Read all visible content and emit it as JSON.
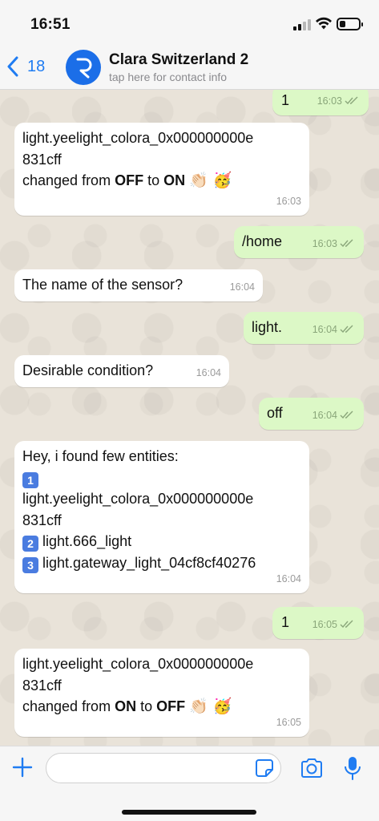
{
  "status_bar": {
    "time": "16:51",
    "battery_level": 0.3
  },
  "header": {
    "back_count": "18",
    "contact_name": "Clara Switzerland 2",
    "contact_subtitle": "tap here for contact info"
  },
  "messages": [
    {
      "direction": "out",
      "text": "1",
      "time": "16:03",
      "read": true
    },
    {
      "direction": "in",
      "line1": "light.yeelight_colora_0x000000000e",
      "line2": "831cff",
      "line3_prefix": "changed from ",
      "from_state": "OFF",
      "to_word": " to ",
      "to_state": "ON",
      "emoji": "👏🏻 🥳",
      "time": "16:03"
    },
    {
      "direction": "out",
      "text": "/home",
      "time": "16:03",
      "read": true
    },
    {
      "direction": "in",
      "text": "The name of the sensor?",
      "time": "16:04"
    },
    {
      "direction": "out",
      "text": "light.",
      "time": "16:04",
      "read": true
    },
    {
      "direction": "in",
      "text": "Desirable condition?",
      "time": "16:04"
    },
    {
      "direction": "out",
      "text": "off",
      "time": "16:04",
      "read": true
    },
    {
      "direction": "in",
      "heading": "Hey, i found few entities:",
      "entities": [
        {
          "num": "1",
          "name_line1": "light.yeelight_colora_0x000000000e",
          "name_line2": "831cff"
        },
        {
          "num": "2",
          "name": "light.666_light"
        },
        {
          "num": "3",
          "name": "light.gateway_light_04cf8cf40276"
        }
      ],
      "time": "16:04"
    },
    {
      "direction": "out",
      "text": "1",
      "time": "16:05",
      "read": true
    },
    {
      "direction": "in",
      "line1": "light.yeelight_colora_0x000000000e",
      "line2": "831cff",
      "line3_prefix": "changed from ",
      "from_state": "ON",
      "to_word": " to ",
      "to_state": "OFF",
      "emoji": "👏🏻 🥳",
      "time": "16:05"
    }
  ],
  "input": {
    "placeholder": ""
  },
  "colors": {
    "accent": "#1f7cf2",
    "outgoing_bubble": "#dcf8c6",
    "incoming_bubble": "#ffffff",
    "chat_background": "#e9e3d9"
  },
  "icons": [
    "back-chevron-icon",
    "avatar-logo-icon",
    "plus-icon",
    "sticker-icon",
    "camera-icon",
    "microphone-icon",
    "read-ticks-icon"
  ]
}
